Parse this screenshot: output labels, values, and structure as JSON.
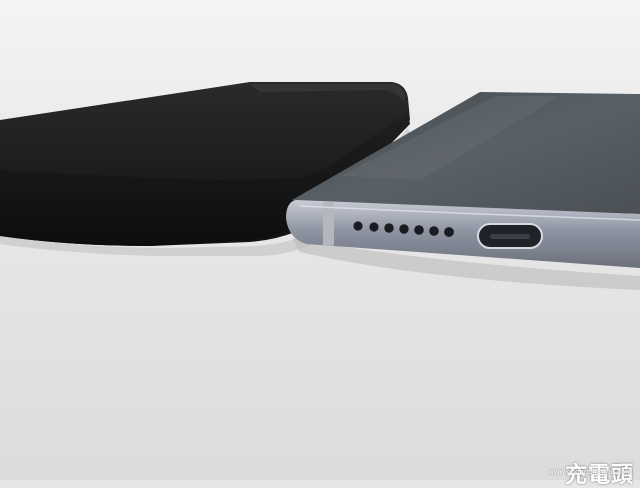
{
  "watermark": {
    "main": "充電頭",
    "sub": "www.chongdiantou.com"
  },
  "colors": {
    "background": "#e6e6e6",
    "case": "#1b1b1b",
    "phone_frame": "#8a8f9c",
    "phone_back": "#4b5155"
  }
}
